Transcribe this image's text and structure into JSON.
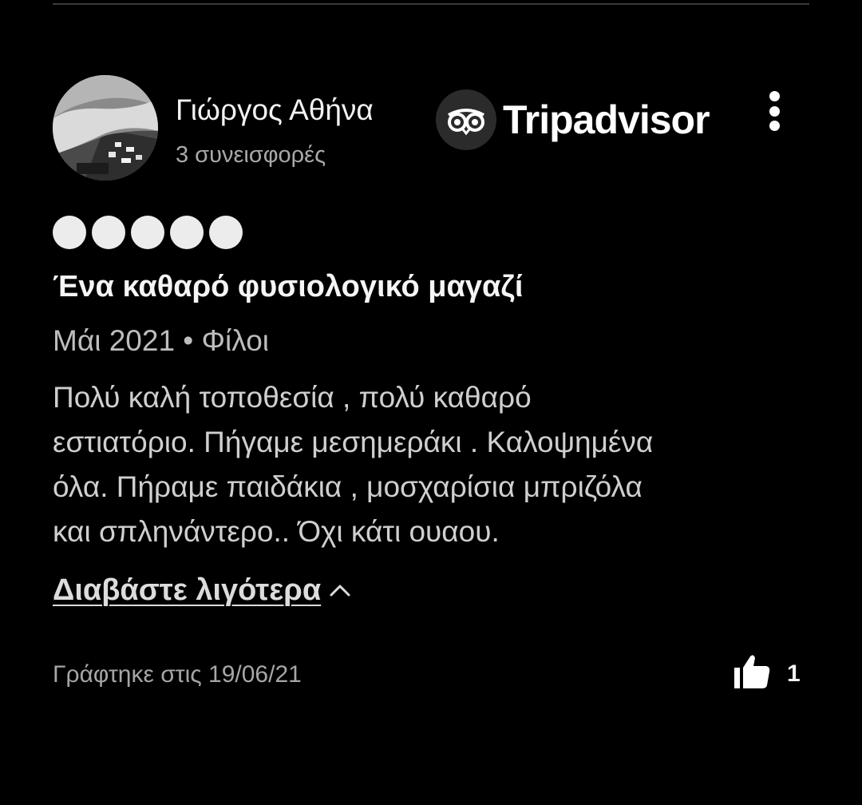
{
  "review": {
    "author": {
      "name": "Γιώργος Αθήνα",
      "contributions": "3 συνεισφορές"
    },
    "brand": {
      "name": "Tripadvisor",
      "icon": "tripadvisor-owl-icon"
    },
    "rating": {
      "value": 5,
      "max": 5
    },
    "title": "Ένα καθαρό φυσιολογικό μαγαζί",
    "meta": "Μάι 2021 • Φίλοι",
    "body_lines": [
      "Πολύ καλή τοποθεσία , πολύ καθαρό",
      "εστιατόριο. Πήγαμε μεσημεράκι . Καλοψημένα",
      "όλα. Πήραμε παιδάκια , μοσχαρίσια μπριζόλα",
      "και σπληνάντερο.. Όχι κάτι ουαου."
    ],
    "read_less_label": "Διαβάστε λιγότερα",
    "written_date": "Γράφτηκε στις 19/06/21",
    "helpful_count": "1"
  },
  "icons": {
    "more": "more-vertical-icon",
    "read_less": "chevron-up-icon",
    "helpful": "thumbs-up-icon"
  },
  "colors": {
    "background": "#000000",
    "text_primary": "#f2f2f2",
    "text_secondary": "#a9a9a9",
    "rating_bubble": "#ececec"
  }
}
